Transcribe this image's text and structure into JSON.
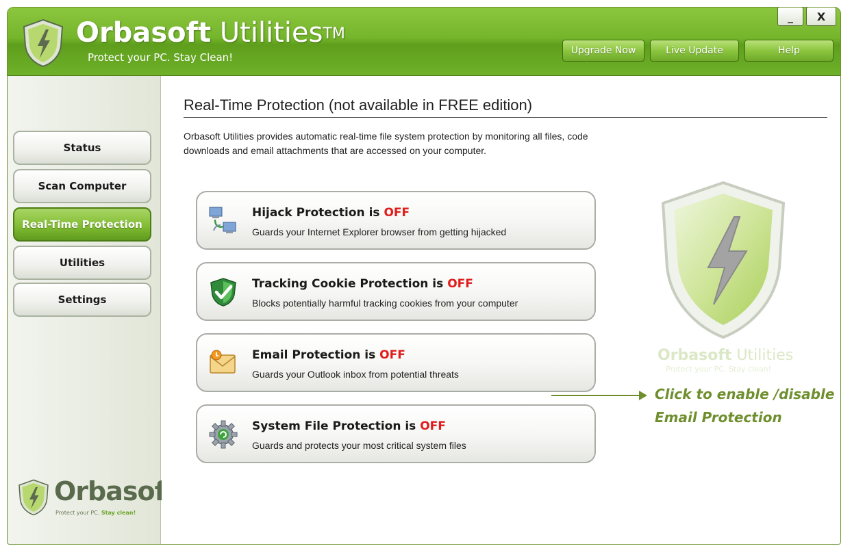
{
  "window": {
    "title_bold": "Orbasoft",
    "title_rest": "Utilities",
    "title_mark": "TM",
    "tagline": "Protect your PC. Stay Clean!",
    "minimize_label": "_",
    "close_label": "X"
  },
  "toolbar": {
    "upgrade_label": "Upgrade Now",
    "live_update_label": "Live Update",
    "help_label": "Help"
  },
  "sidebar": {
    "items": [
      {
        "label": "Status"
      },
      {
        "label": "Scan Computer"
      },
      {
        "label": "Real-Time Protection"
      },
      {
        "label": "Utilities"
      },
      {
        "label": "Settings"
      }
    ],
    "logo_text": "Orbasoft",
    "logo_tag_plain": "Protect your PC.",
    "logo_tag_bold": "Stay clean!"
  },
  "main": {
    "title": "Real-Time Protection (not available in FREE edition)",
    "intro": "Orbasoft Utilities provides automatic real-time file system protection by monitoring all files, code downloads and email attachments that are accessed on your computer.",
    "cards": [
      {
        "title": "Hijack Protection is",
        "status": "OFF",
        "desc": "Guards your Internet Explorer browser from getting hijacked",
        "icon": "network-computers-icon"
      },
      {
        "title": "Tracking Cookie Protection is",
        "status": "OFF",
        "desc": "Blocks potentially harmful tracking cookies from your computer",
        "icon": "shield-check-icon"
      },
      {
        "title": "Email Protection is",
        "status": "OFF",
        "desc": "Guards your Outlook inbox from potential threats",
        "icon": "envelope-icon"
      },
      {
        "title": "System File Protection is",
        "status": "OFF",
        "desc": "Guards and protects your most critical system files",
        "icon": "gear-icon"
      }
    ],
    "watermark_bold": "Orbasoft",
    "watermark_rest": "Utilities",
    "watermark_tag": "Protect your PC. Stay clean!",
    "callout": "Click to enable /disable Email Protection"
  },
  "colors": {
    "brand_green": "#74b52b",
    "status_off": "#e01b1b",
    "callout_green": "#6f8f2f"
  }
}
